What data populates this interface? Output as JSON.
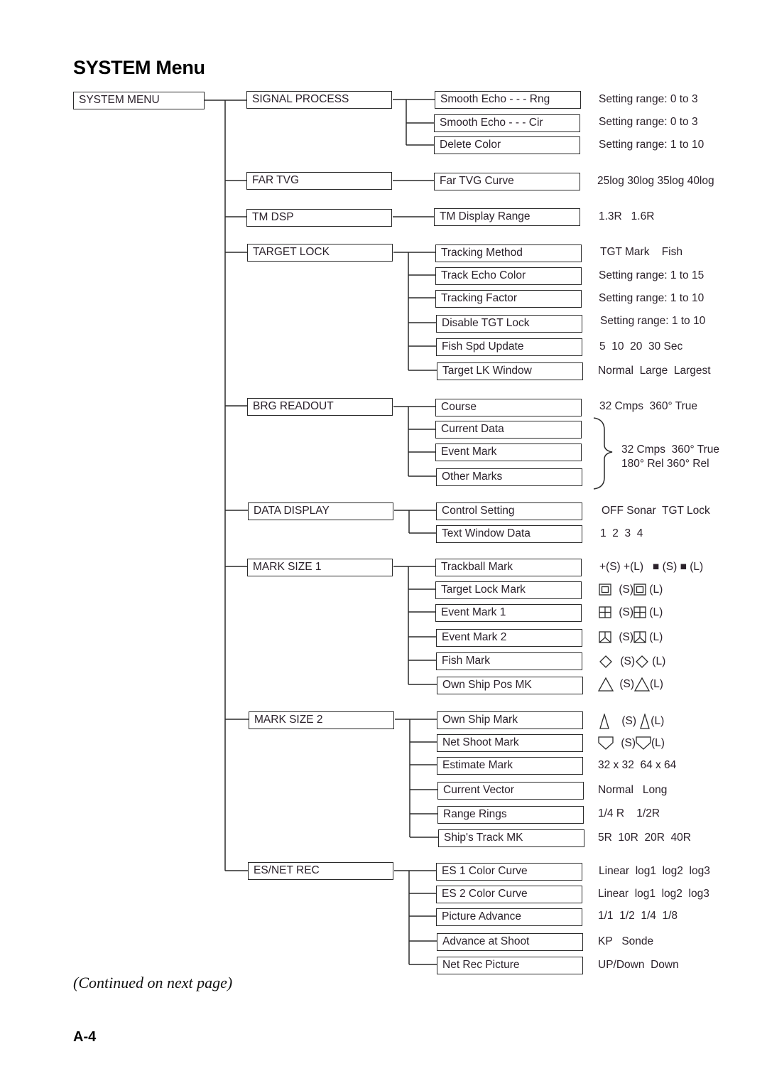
{
  "title": "SYSTEM Menu",
  "root": "SYSTEM MENU",
  "groups": [
    {
      "label": "SIGNAL PROCESS",
      "items": [
        {
          "label": "Smooth Echo - - - Rng",
          "value": "Setting range: 0 to 3"
        },
        {
          "label": "Smooth Echo - - - Cir",
          "value": "Setting range: 0 to 3"
        },
        {
          "label": "Delete Color",
          "value": "Setting range: 1 to 10"
        }
      ]
    },
    {
      "label": "FAR TVG",
      "items": [
        {
          "label": "Far TVG Curve",
          "value": "25log 30log 35log 40log"
        }
      ]
    },
    {
      "label": "TM DSP",
      "items": [
        {
          "label": "TM Display Range",
          "value": "1.3R   1.6R"
        }
      ]
    },
    {
      "label": "TARGET LOCK",
      "items": [
        {
          "label": "Tracking Method",
          "value": "TGT Mark    Fish"
        },
        {
          "label": "Track Echo Color",
          "value": "Setting range: 1 to 15"
        },
        {
          "label": "Tracking Factor",
          "value": "Setting range: 1 to 10"
        },
        {
          "label": "Disable TGT Lock",
          "value": "Setting range: 1 to 10"
        },
        {
          "label": "Fish Spd Update",
          "value": "5  10  20  30 Sec"
        },
        {
          "label": "Target LK Window",
          "value": "Normal  Large  Largest"
        }
      ]
    },
    {
      "label": "BRG READOUT",
      "items": [
        {
          "label": "Course",
          "value": "32 Cmps  360° True"
        },
        {
          "label": "Current Data"
        },
        {
          "label": "Event Mark"
        },
        {
          "label": "Other Marks"
        }
      ],
      "brace_value_line1": "32 Cmps  360° True",
      "brace_value_line2": "180° Rel 360° Rel"
    },
    {
      "label": "DATA DISPLAY",
      "items": [
        {
          "label": "Control Setting",
          "value": "OFF Sonar  TGT Lock"
        },
        {
          "label": "Text Window Data",
          "value": "1  2  3  4"
        }
      ]
    },
    {
      "label": "MARK SIZE 1",
      "items": [
        {
          "label": "Trackball Mark",
          "value": "+(S) +(L)   ■ (S) ■ (L)",
          "icon": "plus-and-filled-square"
        },
        {
          "label": "Target Lock Mark",
          "value_s": "(S)",
          "value_l": "(L)",
          "icon": "double-square-icon"
        },
        {
          "label": "Event Mark 1",
          "value_s": "(S)",
          "value_l": "(L)",
          "icon": "grid-square-icon"
        },
        {
          "label": "Event Mark 2",
          "value_s": "(S)",
          "value_l": "(L)",
          "icon": "square-with-chevron-icon"
        },
        {
          "label": "Fish Mark",
          "value_s": "(S)",
          "value_l": "(L)",
          "icon": "diamond-icon"
        },
        {
          "label": "Own Ship Pos MK",
          "value_s": "(S)",
          "value_l": "(L)",
          "icon": "triangle-icon"
        }
      ]
    },
    {
      "label": "MARK SIZE 2",
      "items": [
        {
          "label": "Own Ship Mark",
          "value_s": "(S)",
          "value_l": "(L)",
          "icon": "narrow-triangle-icon"
        },
        {
          "label": "Net Shoot Mark",
          "value_s": "(S)",
          "value_l": "(L)",
          "icon": "pentagon-down-icon"
        },
        {
          "label": "Estimate Mark",
          "value": "32 x 32  64 x 64"
        },
        {
          "label": "Current Vector",
          "value": "Normal   Long"
        },
        {
          "label": "Range Rings",
          "value": "1/4 R    1/2R"
        },
        {
          "label": "Ship's Track MK",
          "value": "5R  10R  20R  40R"
        }
      ]
    },
    {
      "label": "ES/NET REC",
      "items": [
        {
          "label": "ES 1 Color Curve",
          "value": "Linear  log1  log2  log3"
        },
        {
          "label": "ES 2 Color Curve",
          "value": "Linear  log1  log2  log3"
        },
        {
          "label": "Picture Advance",
          "value": "1/1  1/2  1/4  1/8"
        },
        {
          "label": "Advance at Shoot",
          "value": "KP   Sonde"
        },
        {
          "label": "Net Rec Picture",
          "value": "UP/Down  Down"
        }
      ]
    }
  ],
  "footer_note": "(Continued on next page)",
  "page_number": "A-4"
}
